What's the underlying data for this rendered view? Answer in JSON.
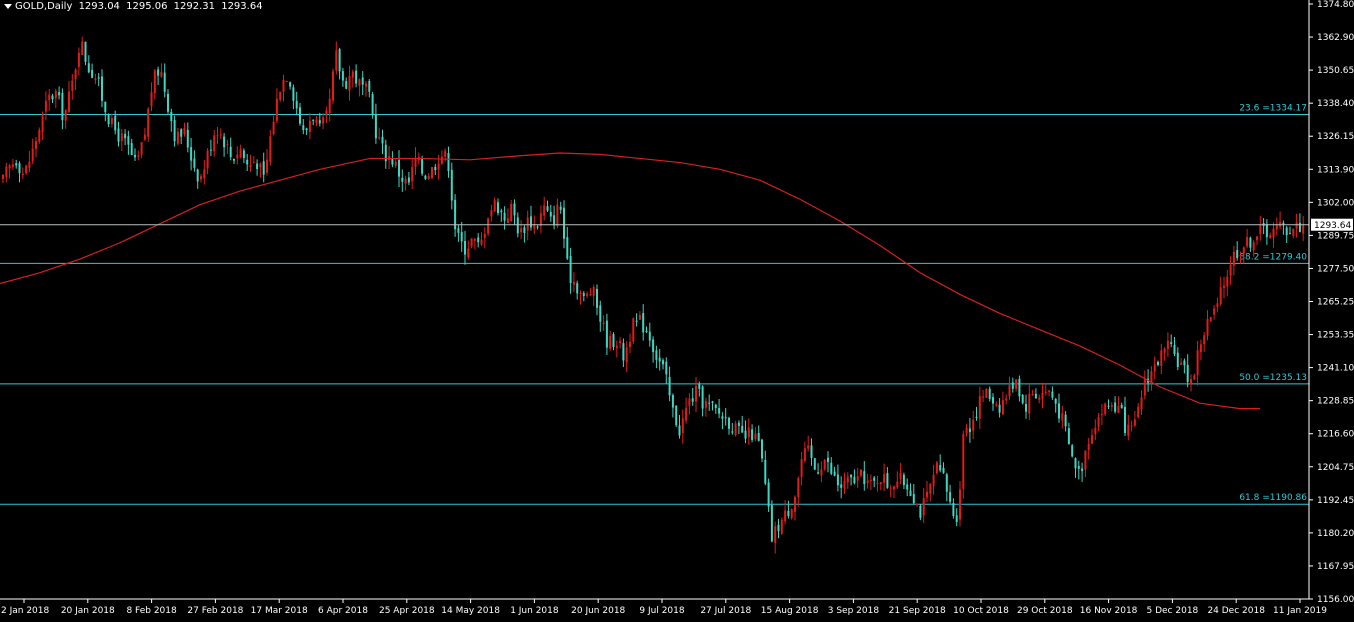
{
  "header": {
    "symbol": "GOLD,Daily",
    "open": "1293.04",
    "high": "1295.06",
    "low": "1292.31",
    "close": "1293.64"
  },
  "colors": {
    "background": "#000000",
    "axis": "#ffffff",
    "bull": "#e41b1b",
    "bear": "#3fd7c4",
    "ma": "#d42020",
    "fib": "#2ec8d6",
    "last_price_line": "#b8c0c0"
  },
  "chart_data": {
    "type": "candlestick",
    "symbol": "GOLD",
    "timeframe": "Daily",
    "ylim": [
      1156.0,
      1374.8
    ],
    "y_ticks": [
      "1374.80",
      "1362.90",
      "1350.65",
      "1338.40",
      "1326.15",
      "1313.90",
      "1302.00",
      "1289.75",
      "1277.50",
      "1265.25",
      "1253.35",
      "1241.10",
      "1228.85",
      "1216.60",
      "1204.75",
      "1192.45",
      "1180.20",
      "1167.95",
      "1156.00"
    ],
    "x_labels": [
      "2 Jan 2018",
      "20 Jan 2018",
      "8 Feb 2018",
      "27 Feb 2018",
      "17 Mar 2018",
      "6 Apr 2018",
      "25 Apr 2018",
      "14 May 2018",
      "1 Jun 2018",
      "20 Jun 2018",
      "9 Jul 2018",
      "27 Jul 2018",
      "15 Aug 2018",
      "3 Sep 2018",
      "21 Sep 2018",
      "10 Oct 2018",
      "29 Oct 2018",
      "16 Nov 2018",
      "5 Dec 2018",
      "24 Dec 2018",
      "11 Jan 2019"
    ],
    "last_price": 1293.64,
    "last_price_label": "1293.64",
    "fib_levels": [
      {
        "value": 1334.17,
        "label": "23.6 =1334.17"
      },
      {
        "value": 1279.4,
        "label": "38.2 =1279.40"
      },
      {
        "value": 1235.13,
        "label": "50.0 =1235.13"
      },
      {
        "value": 1190.86,
        "label": "61.8 =1190.86"
      }
    ],
    "ma_path": [
      [
        0,
        1272
      ],
      [
        40,
        1276
      ],
      [
        80,
        1281
      ],
      [
        120,
        1287
      ],
      [
        160,
        1294
      ],
      [
        200,
        1301
      ],
      [
        240,
        1306
      ],
      [
        280,
        1310
      ],
      [
        320,
        1314
      ],
      [
        370,
        1318
      ],
      [
        420,
        1318
      ],
      [
        470,
        1317.5
      ],
      [
        520,
        1319
      ],
      [
        560,
        1320
      ],
      [
        600,
        1319.5
      ],
      [
        640,
        1318
      ],
      [
        680,
        1316.5
      ],
      [
        720,
        1314
      ],
      [
        760,
        1310
      ],
      [
        800,
        1303
      ],
      [
        840,
        1295
      ],
      [
        880,
        1286
      ],
      [
        920,
        1276
      ],
      [
        960,
        1268
      ],
      [
        1000,
        1261
      ],
      [
        1040,
        1255
      ],
      [
        1080,
        1249
      ],
      [
        1120,
        1242
      ],
      [
        1160,
        1234
      ],
      [
        1200,
        1228
      ],
      [
        1240,
        1226
      ],
      [
        1260,
        1226
      ]
    ],
    "close_path": [
      [
        0,
        1307
      ],
      [
        8,
        1314
      ],
      [
        16,
        1318
      ],
      [
        24,
        1312
      ],
      [
        32,
        1320
      ],
      [
        40,
        1330
      ],
      [
        48,
        1340
      ],
      [
        56,
        1342
      ],
      [
        64,
        1333
      ],
      [
        72,
        1345
      ],
      [
        80,
        1362
      ],
      [
        88,
        1352
      ],
      [
        96,
        1348
      ],
      [
        104,
        1338
      ],
      [
        112,
        1330
      ],
      [
        120,
        1326
      ],
      [
        128,
        1322
      ],
      [
        136,
        1315
      ],
      [
        144,
        1325
      ],
      [
        152,
        1345
      ],
      [
        160,
        1352
      ],
      [
        168,
        1338
      ],
      [
        176,
        1325
      ],
      [
        184,
        1328
      ],
      [
        192,
        1318
      ],
      [
        200,
        1310
      ],
      [
        208,
        1320
      ],
      [
        216,
        1330
      ],
      [
        224,
        1325
      ],
      [
        232,
        1318
      ],
      [
        240,
        1322
      ],
      [
        248,
        1315
      ],
      [
        256,
        1318
      ],
      [
        264,
        1310
      ],
      [
        272,
        1330
      ],
      [
        280,
        1345
      ],
      [
        288,
        1350
      ],
      [
        296,
        1338
      ],
      [
        304,
        1326
      ],
      [
        312,
        1335
      ],
      [
        320,
        1328
      ],
      [
        328,
        1334
      ],
      [
        336,
        1356
      ],
      [
        344,
        1345
      ],
      [
        352,
        1350
      ],
      [
        360,
        1345
      ],
      [
        368,
        1342
      ],
      [
        376,
        1328
      ],
      [
        384,
        1320
      ],
      [
        392,
        1318
      ],
      [
        400,
        1312
      ],
      [
        408,
        1308
      ],
      [
        416,
        1318
      ],
      [
        424,
        1312
      ],
      [
        432,
        1314
      ],
      [
        440,
        1320
      ],
      [
        448,
        1318
      ],
      [
        456,
        1290
      ],
      [
        464,
        1285
      ],
      [
        472,
        1288
      ],
      [
        480,
        1285
      ],
      [
        488,
        1298
      ],
      [
        496,
        1302
      ],
      [
        504,
        1296
      ],
      [
        512,
        1300
      ],
      [
        520,
        1290
      ],
      [
        528,
        1296
      ],
      [
        536,
        1293
      ],
      [
        544,
        1300
      ],
      [
        552,
        1294
      ],
      [
        560,
        1302
      ],
      [
        568,
        1276
      ],
      [
        576,
        1272
      ],
      [
        584,
        1266
      ],
      [
        592,
        1270
      ],
      [
        600,
        1260
      ],
      [
        608,
        1250
      ],
      [
        616,
        1252
      ],
      [
        624,
        1245
      ],
      [
        632,
        1256
      ],
      [
        640,
        1258
      ],
      [
        648,
        1255
      ],
      [
        656,
        1246
      ],
      [
        664,
        1240
      ],
      [
        672,
        1226
      ],
      [
        680,
        1218
      ],
      [
        688,
        1228
      ],
      [
        696,
        1232
      ],
      [
        704,
        1228
      ],
      [
        712,
        1226
      ],
      [
        720,
        1224
      ],
      [
        728,
        1222
      ],
      [
        736,
        1218
      ],
      [
        744,
        1215
      ],
      [
        752,
        1217
      ],
      [
        760,
        1212
      ],
      [
        766,
        1195
      ],
      [
        772,
        1178
      ],
      [
        778,
        1183
      ],
      [
        784,
        1186
      ],
      [
        790,
        1190
      ],
      [
        796,
        1196
      ],
      [
        802,
        1208
      ],
      [
        808,
        1210
      ],
      [
        816,
        1203
      ],
      [
        824,
        1208
      ],
      [
        832,
        1202
      ],
      [
        840,
        1197
      ],
      [
        848,
        1199
      ],
      [
        856,
        1200
      ],
      [
        864,
        1201
      ],
      [
        872,
        1197
      ],
      [
        880,
        1202
      ],
      [
        888,
        1198
      ],
      [
        896,
        1200
      ],
      [
        904,
        1199
      ],
      [
        912,
        1196
      ],
      [
        920,
        1188
      ],
      [
        928,
        1194
      ],
      [
        936,
        1204
      ],
      [
        944,
        1200
      ],
      [
        952,
        1188
      ],
      [
        958,
        1187
      ],
      [
        964,
        1220
      ],
      [
        970,
        1220
      ],
      [
        976,
        1225
      ],
      [
        984,
        1232
      ],
      [
        992,
        1230
      ],
      [
        1000,
        1227
      ],
      [
        1008,
        1232
      ],
      [
        1016,
        1238
      ],
      [
        1024,
        1226
      ],
      [
        1032,
        1232
      ],
      [
        1040,
        1231
      ],
      [
        1048,
        1233
      ],
      [
        1056,
        1228
      ],
      [
        1064,
        1220
      ],
      [
        1072,
        1208
      ],
      [
        1080,
        1202
      ],
      [
        1088,
        1215
      ],
      [
        1096,
        1222
      ],
      [
        1104,
        1226
      ],
      [
        1112,
        1228
      ],
      [
        1120,
        1225
      ],
      [
        1128,
        1217
      ],
      [
        1136,
        1220
      ],
      [
        1144,
        1236
      ],
      [
        1152,
        1240
      ],
      [
        1160,
        1245
      ],
      [
        1168,
        1248
      ],
      [
        1176,
        1245
      ],
      [
        1184,
        1240
      ],
      [
        1192,
        1236
      ],
      [
        1200,
        1250
      ],
      [
        1208,
        1258
      ],
      [
        1216,
        1262
      ],
      [
        1224,
        1272
      ],
      [
        1232,
        1282
      ],
      [
        1240,
        1285
      ],
      [
        1248,
        1287
      ],
      [
        1256,
        1290
      ],
      [
        1264,
        1292
      ],
      [
        1272,
        1291
      ],
      [
        1280,
        1293
      ],
      [
        1288,
        1292
      ],
      [
        1296,
        1293
      ],
      [
        1304,
        1293.64
      ]
    ]
  }
}
